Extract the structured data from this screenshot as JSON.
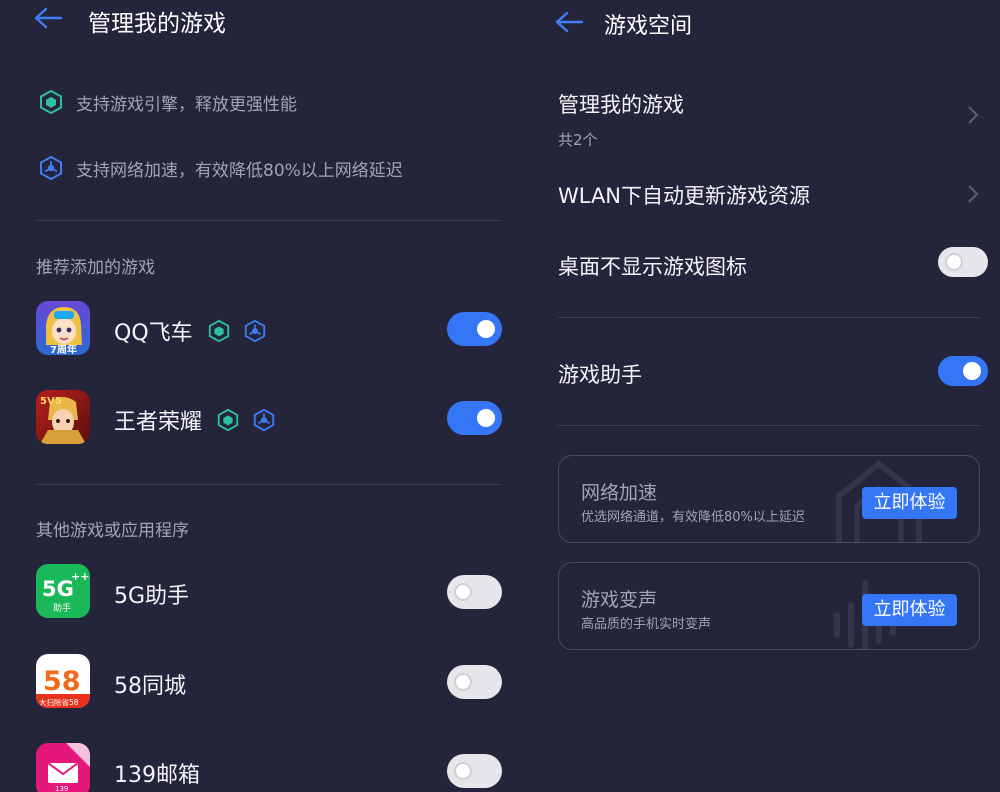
{
  "left_panel": {
    "title": "管理我的游戏",
    "features": [
      {
        "icon": "game-engine-icon",
        "text": "支持游戏引擎，释放更强性能"
      },
      {
        "icon": "network-accelerate-icon",
        "text": "支持网络加速，有效降低80%以上网络延迟"
      }
    ],
    "recommended_label": "推荐添加的游戏",
    "recommended": [
      {
        "name": "QQ飞车",
        "icon": "qq-speed-app-icon",
        "enabled": true
      },
      {
        "name": "王者荣耀",
        "icon": "honor-of-kings-app-icon",
        "enabled": true
      }
    ],
    "others_label": "其他游戏或应用程序",
    "others": [
      {
        "name": "5G助手",
        "icon": "5g-assistant-app-icon",
        "enabled": false
      },
      {
        "name": "58同城",
        "icon": "58-tongcheng-app-icon",
        "enabled": false
      },
      {
        "name": "139邮箱",
        "icon": "139-mail-app-icon",
        "enabled": false
      }
    ],
    "icon_text": {
      "fiveg": "5G",
      "fiveg_sub": "助手",
      "fiveg_plus": "++",
      "tc_num": "58",
      "tc_banner": "大扫除省58",
      "mail_num": "139",
      "kart_label": "7周年",
      "hok_label": "5V5"
    }
  },
  "right_panel": {
    "title": "游戏空间",
    "manage": {
      "label": "管理我的游戏",
      "sub": "共2个"
    },
    "wlan_update": {
      "label": "WLAN下自动更新游戏资源"
    },
    "hide_icon": {
      "label": "桌面不显示游戏图标",
      "enabled": false
    },
    "assistant": {
      "label": "游戏助手",
      "enabled": true
    },
    "cards": [
      {
        "title": "网络加速",
        "desc": "优选网络通道，有效降低80%以上延迟",
        "button": "立即体验"
      },
      {
        "title": "游戏变声",
        "desc": "高品质的手机实时变声",
        "button": "立即体验"
      }
    ]
  },
  "colors": {
    "background": "#24243a",
    "accent": "#3476f6",
    "engine_icon": "#2fbf9e",
    "network_icon": "#3f7cf5"
  }
}
